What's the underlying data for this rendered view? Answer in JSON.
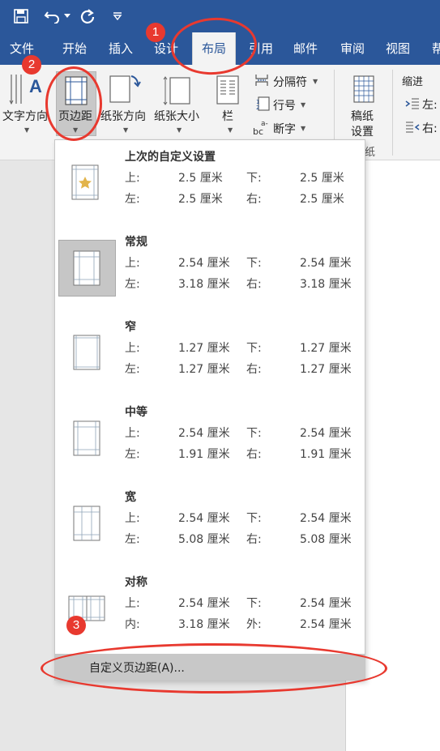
{
  "quick_access": {
    "save_icon": "save-icon",
    "undo_icon": "undo-icon",
    "redo_icon": "redo-icon",
    "customize_icon": "customize-icon"
  },
  "tabs": [
    {
      "label": "文件"
    },
    {
      "label": "开始"
    },
    {
      "label": "插入"
    },
    {
      "label": "设计"
    },
    {
      "label": "布局"
    },
    {
      "label": "引用"
    },
    {
      "label": "邮件"
    },
    {
      "label": "审阅"
    },
    {
      "label": "视图"
    },
    {
      "label": "帮"
    }
  ],
  "ribbon": {
    "text_direction": "文字方向",
    "margins": "页边距",
    "orientation": "纸张方向",
    "size": "纸张大小",
    "columns": "栏",
    "breaks": "分隔符",
    "line_numbers": "行号",
    "hyphenation": "断字",
    "manuscript_line1": "稿纸",
    "manuscript_line2": "设置",
    "manuscript_group": "纸",
    "indent": "缩进",
    "indent_left": "左:",
    "indent_right": "右:"
  },
  "margin_presets": [
    {
      "title": "上次的自定义设置",
      "k1": "上:",
      "v1": "2.5 厘米",
      "k2": "下:",
      "v2": "2.5 厘米",
      "k3": "左:",
      "v3": "2.5 厘米",
      "k4": "右:",
      "v4": "2.5 厘米"
    },
    {
      "title": "常规",
      "k1": "上:",
      "v1": "2.54 厘米",
      "k2": "下:",
      "v2": "2.54 厘米",
      "k3": "左:",
      "v3": "3.18 厘米",
      "k4": "右:",
      "v4": "3.18 厘米"
    },
    {
      "title": "窄",
      "k1": "上:",
      "v1": "1.27 厘米",
      "k2": "下:",
      "v2": "1.27 厘米",
      "k3": "左:",
      "v3": "1.27 厘米",
      "k4": "右:",
      "v4": "1.27 厘米"
    },
    {
      "title": "中等",
      "k1": "上:",
      "v1": "2.54 厘米",
      "k2": "下:",
      "v2": "2.54 厘米",
      "k3": "左:",
      "v3": "1.91 厘米",
      "k4": "右:",
      "v4": "1.91 厘米"
    },
    {
      "title": "宽",
      "k1": "上:",
      "v1": "2.54 厘米",
      "k2": "下:",
      "v2": "2.54 厘米",
      "k3": "左:",
      "v3": "5.08 厘米",
      "k4": "右:",
      "v4": "5.08 厘米"
    },
    {
      "title": "对称",
      "k1": "上:",
      "v1": "2.54 厘米",
      "k2": "下:",
      "v2": "2.54 厘米",
      "k3": "内:",
      "v3": "3.18 厘米",
      "k4": "外:",
      "v4": "2.54 厘米"
    }
  ],
  "custom_margins": "自定义页边距(A)...",
  "annotations": {
    "b1": "1",
    "b2": "2",
    "b3": "3",
    "color": "#e8392f"
  },
  "colors": {
    "ribbon_blue": "#2b579a",
    "selected_gray": "#c6c6c6"
  }
}
